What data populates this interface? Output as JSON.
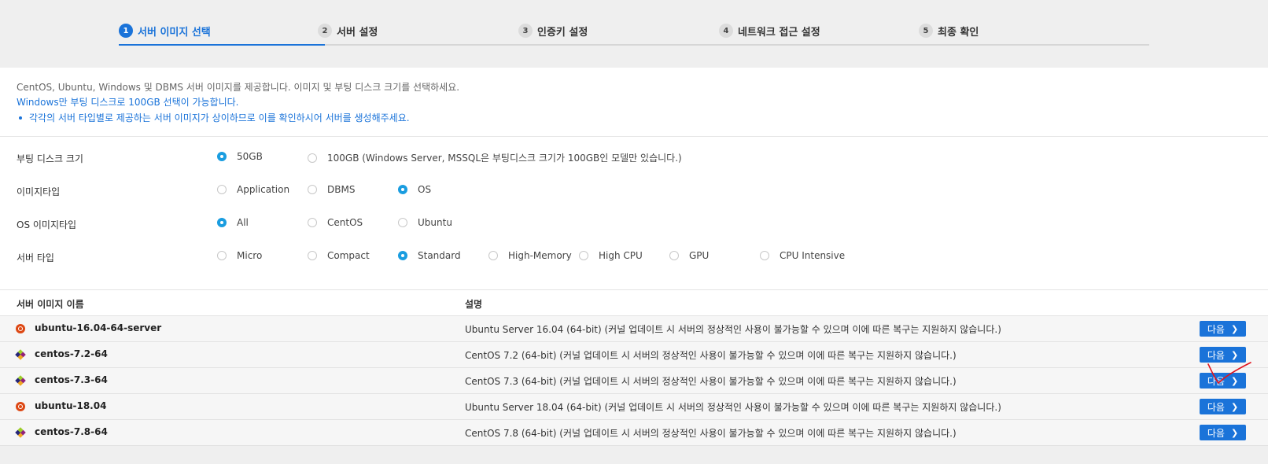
{
  "steps": [
    {
      "num": "1",
      "label": "서버 이미지 선택",
      "active": true
    },
    {
      "num": "2",
      "label": "서버 설정"
    },
    {
      "num": "3",
      "label": "인증키 설정"
    },
    {
      "num": "4",
      "label": "네트워크 접근 설정"
    },
    {
      "num": "5",
      "label": "최종 확인"
    }
  ],
  "notice": {
    "line1": "CentOS, Ubuntu, Windows 및 DBMS 서버 이미지를 제공합니다. 이미지 및 부팅 디스크 크기를 선택하세요.",
    "line2": "Windows만 부팅 디스크로 100GB 선택이 가능합니다.",
    "line3": "각각의 서버 타입별로 제공하는 서버 이미지가 상이하므로 이를 확인하시어 서버를 생성해주세요."
  },
  "options": {
    "boot_disk": {
      "label": "부팅 디스크 크기",
      "choices": [
        "50GB",
        "100GB (Windows Server, MSSQL은 부팅디스크 크기가 100GB인 모델만 있습니다.)"
      ],
      "selected": "50GB"
    },
    "image_type": {
      "label": "이미지타입",
      "choices": [
        "Application",
        "DBMS",
        "OS"
      ],
      "selected": "OS"
    },
    "os_image_type": {
      "label": "OS 이미지타입",
      "choices": [
        "All",
        "CentOS",
        "Ubuntu"
      ],
      "selected": "All"
    },
    "server_type": {
      "label": "서버 타입",
      "choices": [
        "Micro",
        "Compact",
        "Standard",
        "High-Memory",
        "High CPU",
        "GPU",
        "CPU Intensive"
      ],
      "selected": "Standard"
    }
  },
  "table": {
    "headers": {
      "name": "서버 이미지 이름",
      "desc": "설명"
    },
    "next_label": "다음",
    "rows": [
      {
        "icon": "ubuntu-icon",
        "name": "ubuntu-16.04-64-server",
        "desc": "Ubuntu Server 16.04 (64-bit) (커널 업데이트 시 서버의 정상적인 사용이 불가능할 수 있으며 이에 따른 복구는 지원하지 않습니다.)"
      },
      {
        "icon": "centos-icon",
        "name": "centos-7.2-64",
        "desc": "CentOS 7.2 (64-bit) (커널 업데이트 시 서버의 정상적인 사용이 불가능할 수 있으며 이에 따른 복구는 지원하지 않습니다.)"
      },
      {
        "icon": "centos-icon",
        "name": "centos-7.3-64",
        "desc": "CentOS 7.3 (64-bit) (커널 업데이트 시 서버의 정상적인 사용이 불가능할 수 있으며 이에 따른 복구는 지원하지 않습니다.)"
      },
      {
        "icon": "ubuntu-icon",
        "name": "ubuntu-18.04",
        "desc": "Ubuntu Server 18.04 (64-bit) (커널 업데이트 시 서버의 정상적인 사용이 불가능할 수 있으며 이에 따른 복구는 지원하지 않습니다.)"
      },
      {
        "icon": "centos-icon",
        "name": "centos-7.8-64",
        "desc": "CentOS 7.8 (64-bit) (커널 업데이트 시 서버의 정상적인 사용이 불가능할 수 있으며 이에 따른 복구는 지원하지 않습니다.)"
      }
    ]
  },
  "colors": {
    "accent": "#1a73d9",
    "radio_on": "#1a9de0",
    "annotation": "#e0141e"
  }
}
